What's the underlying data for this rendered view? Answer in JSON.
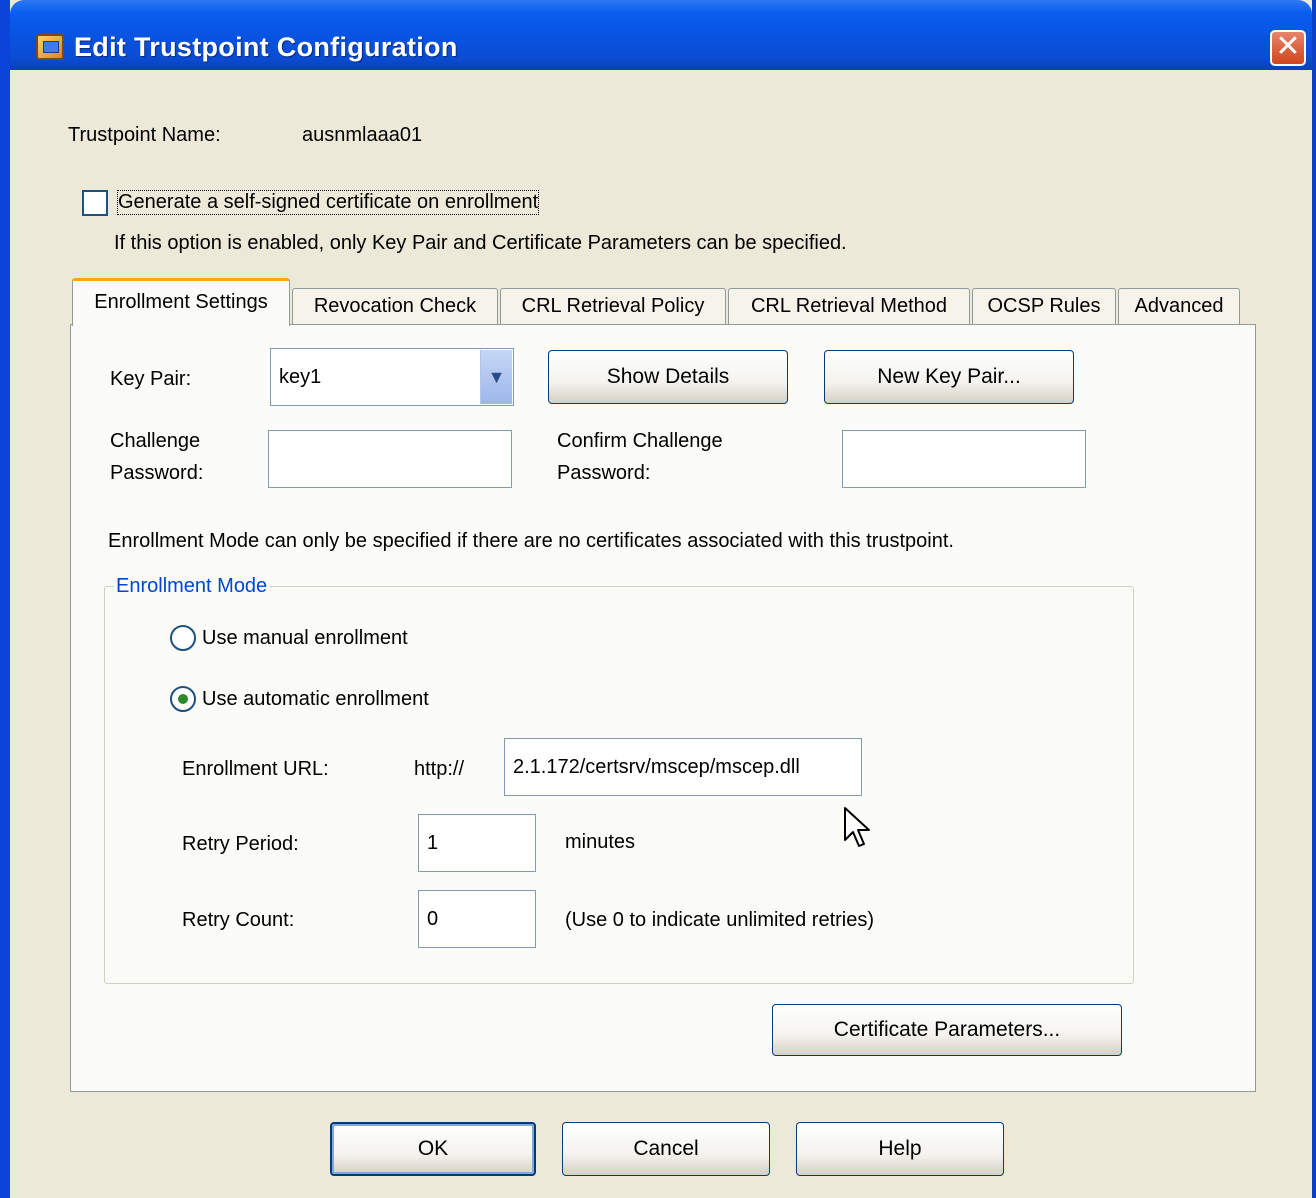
{
  "window": {
    "title": "Edit Trustpoint Configuration",
    "close_glyph": "✕",
    "accent": "#0a5ef0"
  },
  "trustpoint": {
    "name_label": "Trustpoint Name:",
    "name_value": "ausnmlaaa01"
  },
  "self_signed": {
    "checked": false,
    "label": "Generate a self-signed certificate on enrollment",
    "note": "If this option is enabled, only Key Pair and Certificate Parameters can be specified."
  },
  "tabs": [
    {
      "label": "Enrollment Settings",
      "active": true
    },
    {
      "label": "Revocation Check",
      "active": false
    },
    {
      "label": "CRL Retrieval Policy",
      "active": false
    },
    {
      "label": "CRL Retrieval Method",
      "active": false
    },
    {
      "label": "OCSP Rules",
      "active": false
    },
    {
      "label": "Advanced",
      "active": false
    }
  ],
  "enrollment": {
    "key_pair_label": "Key Pair:",
    "key_pair_value": "key1",
    "show_details_label": "Show Details",
    "new_key_pair_label": "New Key Pair...",
    "challenge_label_1": "Challenge",
    "challenge_label_2": "Password:",
    "challenge_value": "",
    "confirm_label_1": "Confirm Challenge",
    "confirm_label_2": "Password:",
    "confirm_value": "",
    "mode_note": "Enrollment Mode can only be specified if there are no certificates associated with this trustpoint.",
    "mode_group_title": "Enrollment Mode",
    "manual_label": "Use manual enrollment",
    "automatic_label": "Use automatic enrollment",
    "selected_mode": "automatic",
    "url_label": "Enrollment URL:",
    "url_prefix": "http://",
    "url_value": "2.1.172/certsrv/mscep/mscep.dll",
    "retry_period_label": "Retry Period:",
    "retry_period_value": "1",
    "retry_period_unit": "minutes",
    "retry_count_label": "Retry Count:",
    "retry_count_value": "0",
    "retry_count_hint": "(Use 0 to indicate unlimited retries)",
    "cert_params_label": "Certificate Parameters..."
  },
  "footer": {
    "ok_label": "OK",
    "cancel_label": "Cancel",
    "help_label": "Help"
  }
}
